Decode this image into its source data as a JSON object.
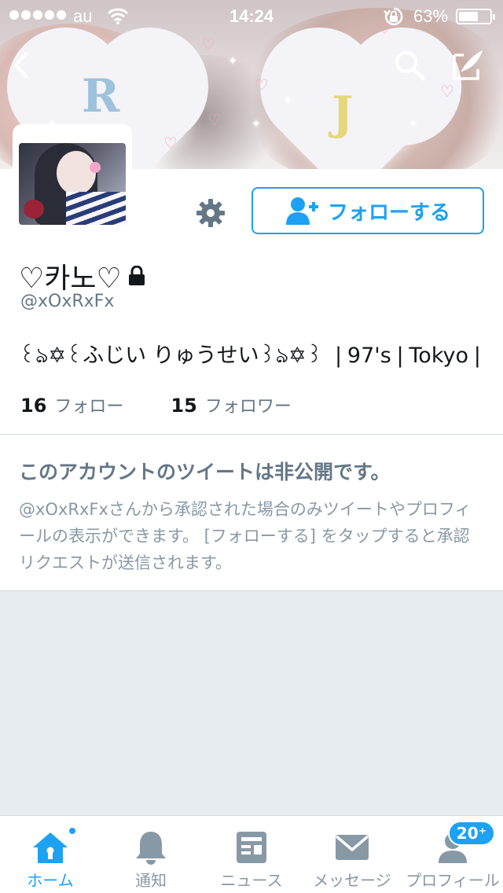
{
  "status_bar": {
    "carrier": "au",
    "time": "14:24",
    "battery_percent_text": "63%",
    "battery_level": 0.63
  },
  "profile": {
    "display_name": "♡카노♡",
    "handle": "@xOxRxFx",
    "bio": "꒰ঌ✡꒰ふじい りゅうせい꒱ঌ✡꒱ ❘97's❘Tokyo❘",
    "following_count": "16",
    "following_label": "フォロー",
    "followers_count": "15",
    "followers_label": "フォロワー",
    "follow_button_label": "フォローする",
    "header_heart_letters": [
      "R",
      "J"
    ]
  },
  "protected_notice": {
    "title": "このアカウントのツイートは非公開です。",
    "body": "@xOxRxFxさんから承認された場合のみツイートやプロフィールの表示ができます。 [フォローする] をタップすると承認リクエストが送信されます。"
  },
  "tabs": [
    {
      "label": "ホーム",
      "icon": "home-icon",
      "active": true
    },
    {
      "label": "通知",
      "icon": "bell-icon",
      "active": false
    },
    {
      "label": "ニュース",
      "icon": "news-icon",
      "active": false
    },
    {
      "label": "メッセージ",
      "icon": "envelope-icon",
      "active": false
    },
    {
      "label": "プロフィール",
      "icon": "profile-icon",
      "active": false,
      "badge": "20⁺"
    }
  ],
  "colors": {
    "accent": "#1da1f2",
    "muted_text": "#657786",
    "background": "#e6ecf0"
  }
}
